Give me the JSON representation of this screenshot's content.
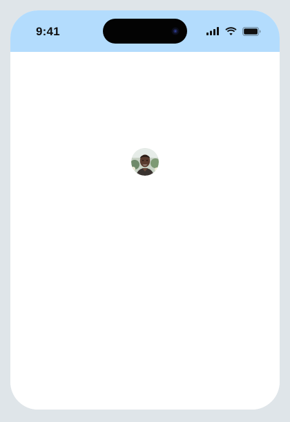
{
  "status_bar": {
    "time": "9:41",
    "background_color": "#b3dcfd",
    "icons": [
      "cellular-signal-icon",
      "wifi-icon",
      "battery-icon"
    ]
  },
  "content": {
    "background_color": "#ffffff",
    "avatar": {
      "description_icon": "user-avatar-photo"
    }
  }
}
